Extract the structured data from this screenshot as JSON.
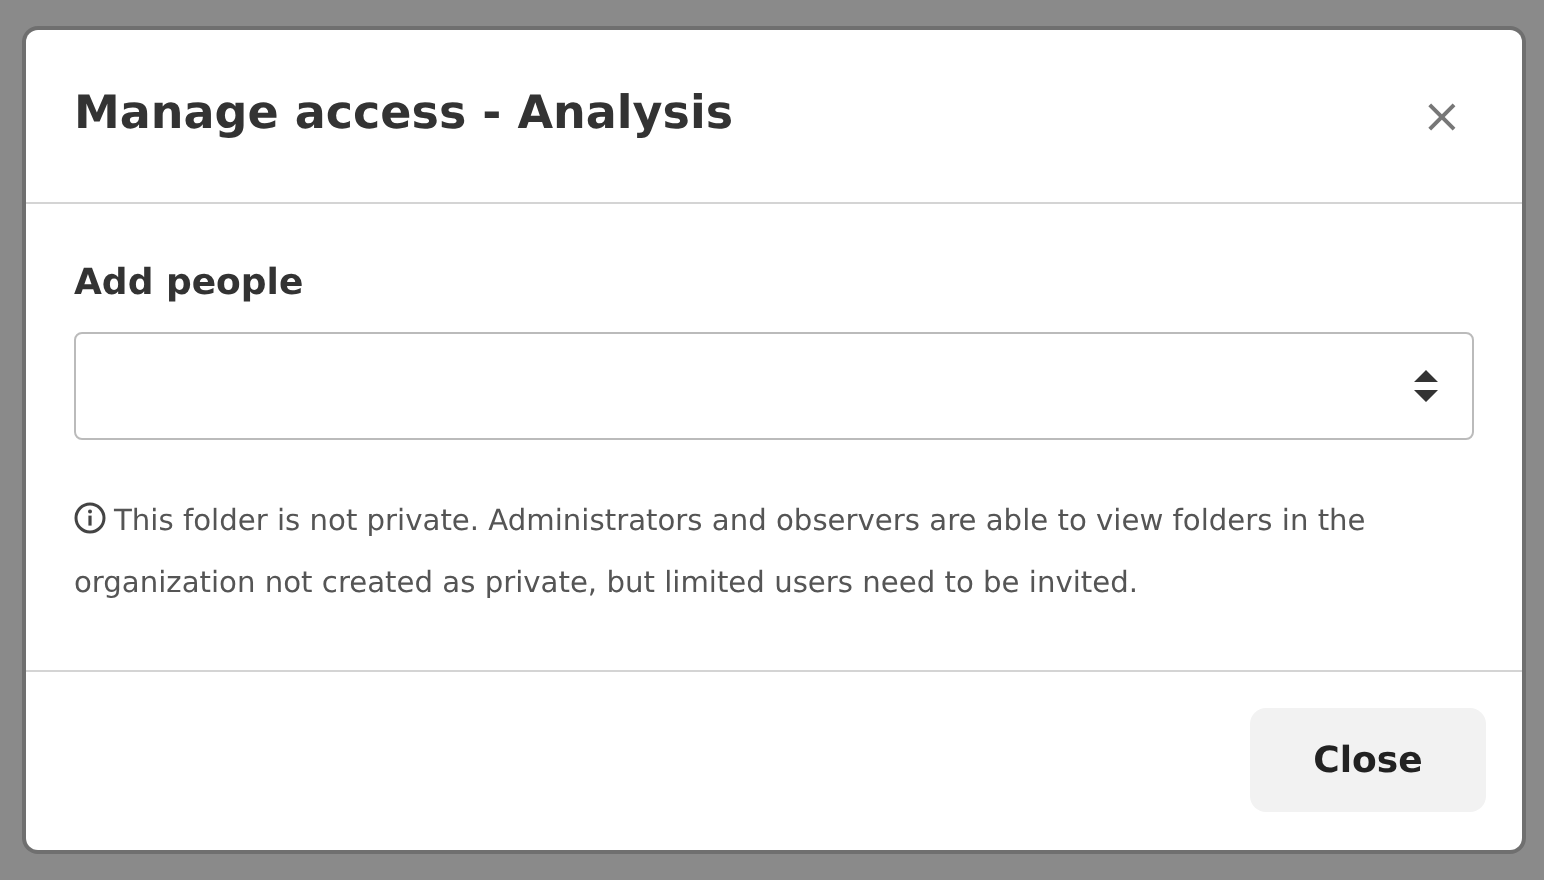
{
  "dialog": {
    "title": "Manage access - Analysis",
    "close_glyph": "×",
    "field": {
      "label": "Add people"
    },
    "note": "This folder is not private. Administrators and observers are able to view folders in the organization not created as private, but limited users need to be invited.",
    "buttons": [
      "Close"
    ]
  }
}
